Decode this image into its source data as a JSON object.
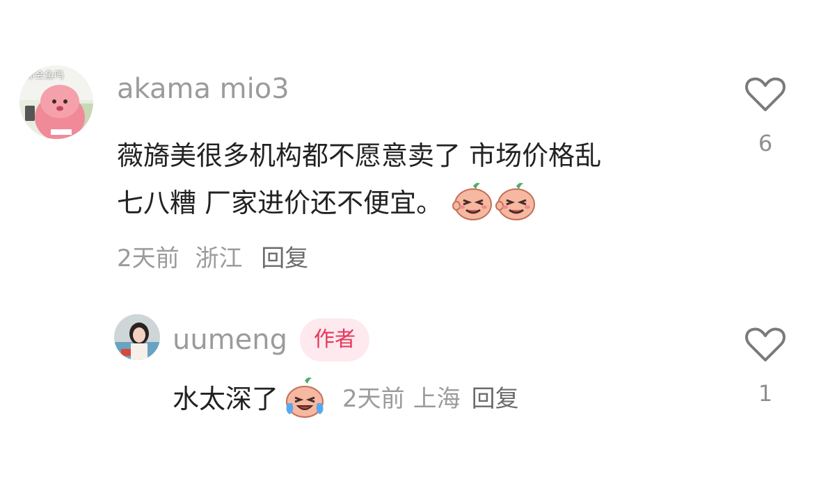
{
  "comments": [
    {
      "avatar_overlay_text": "你会鱼吗",
      "username": "akama mio3",
      "text_line1": "薇旖美很多机构都不愿意卖了 市场价格乱",
      "text_line2": "七八糟 厂家进价还不便宜。",
      "emoji": [
        "laughing-face-emoji",
        "laughing-face-emoji"
      ],
      "time": "2天前",
      "location": "浙江",
      "reply_label": "回复",
      "likes": "6"
    }
  ],
  "reply": {
    "username": "uumeng",
    "badge": "作者",
    "text": "水太深了",
    "emoji": "crying-face-emoji",
    "time": "2天前",
    "location": "上海",
    "reply_label": "回复",
    "likes": "1"
  },
  "colors": {
    "username": "#9b9b9b",
    "text": "#222222",
    "badge_bg": "#fde9ee",
    "badge_text": "#e4385a"
  }
}
